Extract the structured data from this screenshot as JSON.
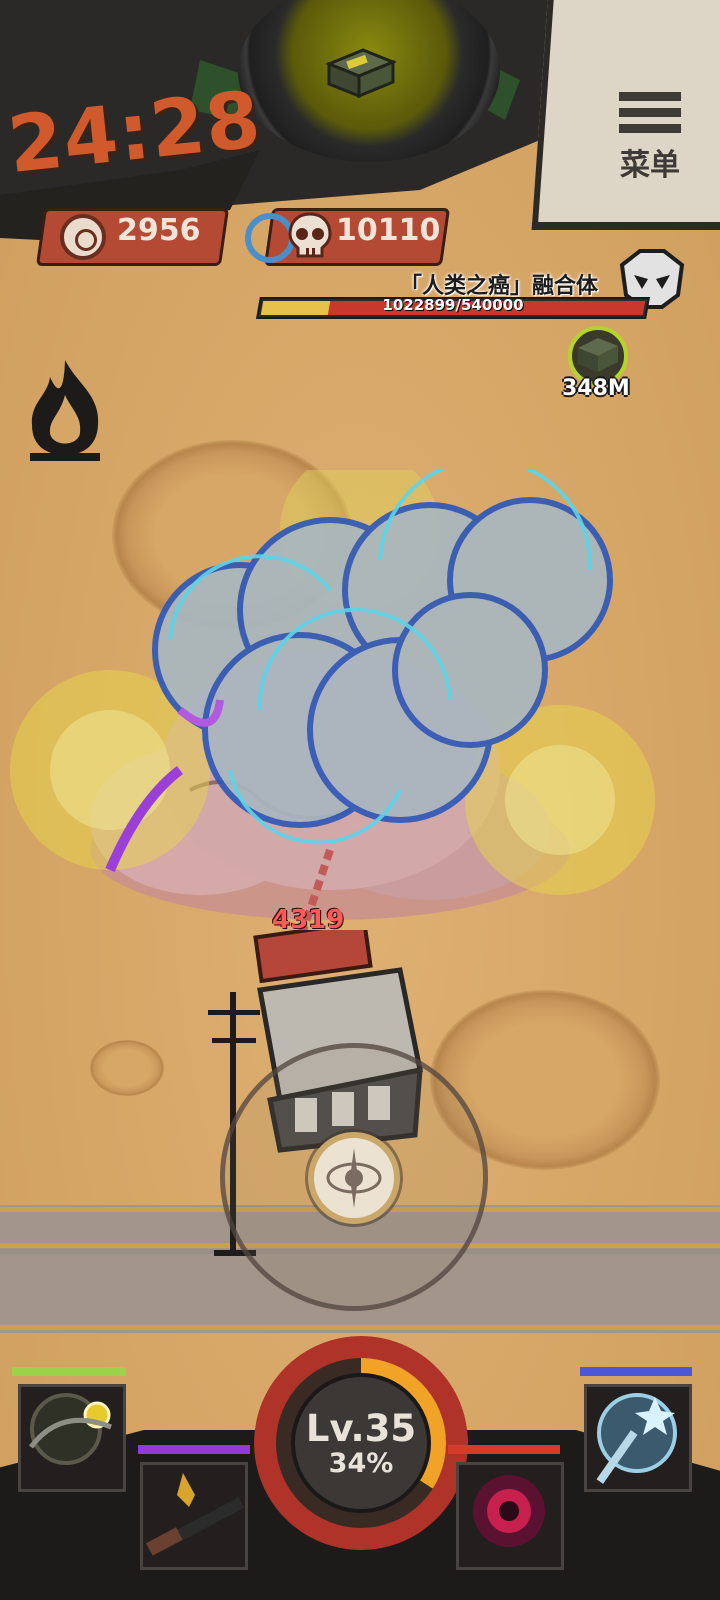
{
  "hud": {
    "timer": "24:28",
    "menu_label": "菜单",
    "coins": "2956",
    "kills": "10110"
  },
  "boss": {
    "name": "「人类之癌」融合体",
    "hp_text": "1022899/540000"
  },
  "target_marker": {
    "distance": "348M"
  },
  "combat": {
    "damage_number": "4319"
  },
  "player": {
    "level": "Lv.35",
    "xp_percent": "34%",
    "xp_fraction": 0.34
  },
  "skill_slots": [
    {
      "name": "scythe-chain-skill",
      "bar_color": "#9bd24a"
    },
    {
      "name": "shotgun-skill",
      "bar_color": "#8f3bd6"
    },
    {
      "name": "crimson-orb-skill",
      "bar_color": "#d63a2a"
    },
    {
      "name": "ice-staff-skill",
      "bar_color": "#4b57d6"
    }
  ],
  "colors": {
    "timer": "#d05a2c",
    "counter_bg": "#b44a33",
    "boss_hp_yellow": "#e7c24a",
    "boss_hp_red": "#c9382c",
    "xp_ring": "#f0a326"
  },
  "icons": [
    "menu-icon",
    "coin-icon",
    "skull-icon",
    "fire-icon",
    "ammo-box-icon",
    "joystick-icon",
    "boss-skull-icon"
  ]
}
